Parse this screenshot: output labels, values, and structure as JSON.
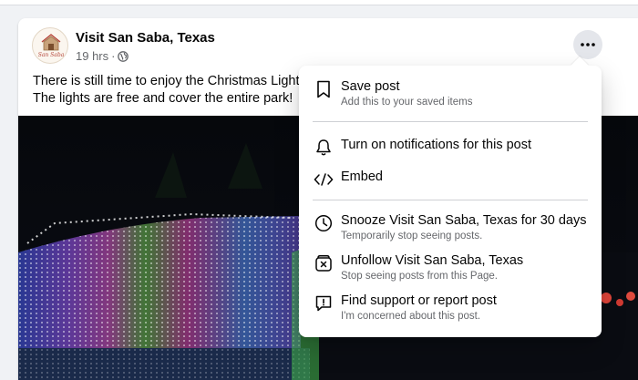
{
  "post": {
    "page_name": "Visit San Saba, Texas",
    "time": "19 hrs",
    "separator": "·",
    "text_line1": "There is still time to enjoy the Christmas Lights",
    "text_line2": "The lights are free and cover the entire park!",
    "avatar_text": "San Saba",
    "more_icon": "more-horizontal-icon"
  },
  "menu": {
    "items": [
      {
        "title": "Save post",
        "subtitle": "Add this to your saved items",
        "icon": "bookmark-icon"
      },
      {
        "title": "Turn on notifications for this post",
        "subtitle": "",
        "icon": "bell-icon"
      },
      {
        "title": "Embed",
        "subtitle": "",
        "icon": "code-icon"
      },
      {
        "title": "Snooze Visit San Saba, Texas for 30 days",
        "subtitle": "Temporarily stop seeing posts.",
        "icon": "clock-icon"
      },
      {
        "title": "Unfollow Visit San Saba, Texas",
        "subtitle": "Stop seeing posts from this Page.",
        "icon": "unfollow-icon"
      },
      {
        "title": "Find support or report post",
        "subtitle": "I'm concerned about this post.",
        "icon": "report-icon"
      }
    ]
  },
  "colors": {
    "background": "#f0f2f5",
    "card": "#ffffff",
    "primary_text": "#050505",
    "secondary_text": "#65676b",
    "divider": "#ced0d4"
  }
}
